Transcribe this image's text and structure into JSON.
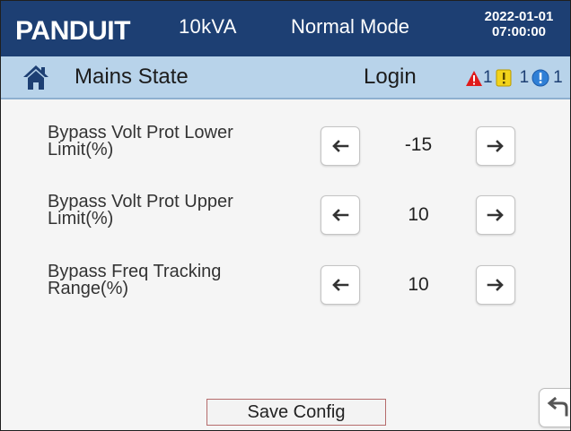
{
  "header": {
    "logo_text": "PANDUIT",
    "model": "10kVA",
    "mode": "Normal Mode",
    "date": "2022-01-01",
    "time": "07:00:00",
    "background_color": "#1d3f73"
  },
  "subheader": {
    "home_icon": "home-icon",
    "title": "Mains State",
    "login_label": "Login",
    "alarms": {
      "critical_icon": "red-warning-triangle-icon",
      "critical_count": "1",
      "warning_icon": "yellow-exclamation-icon",
      "warning_count": "1",
      "info_icon": "blue-info-circle-icon",
      "info_count": "1"
    },
    "background_color": "#b8d3ea"
  },
  "settings": [
    {
      "label": "Bypass Volt  Prot Lower Limit(%)",
      "value": "-15",
      "decrease_icon": "arrow-left-icon",
      "increase_icon": "arrow-right-icon"
    },
    {
      "label": "Bypass Volt  Prot Upper Limit(%)",
      "value": "10",
      "decrease_icon": "arrow-left-icon",
      "increase_icon": "arrow-right-icon"
    },
    {
      "label": "Bypass Freq Tracking Range(%)",
      "value": "10",
      "decrease_icon": "arrow-left-icon",
      "increase_icon": "arrow-right-icon"
    }
  ],
  "footer": {
    "save_label": "Save Config",
    "back_icon": "back-return-icon"
  }
}
